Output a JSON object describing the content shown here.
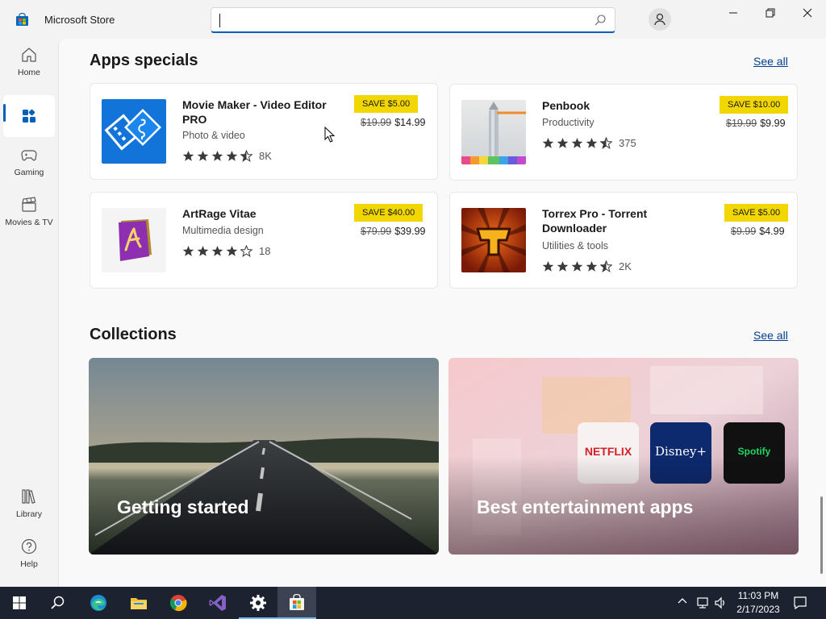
{
  "window": {
    "title": "Microsoft Store",
    "search_value": "",
    "controls": [
      "minimize-icon",
      "restore-icon",
      "close-icon"
    ]
  },
  "nav": {
    "items": [
      {
        "label": "Home",
        "icon": "home-icon"
      },
      {
        "label": "",
        "icon": "apps-icon",
        "active": true
      },
      {
        "label": "Gaming",
        "icon": "gamepad-icon"
      },
      {
        "label": "Movies & TV",
        "icon": "clapper-icon"
      },
      {
        "label": "Library",
        "icon": "library-icon"
      },
      {
        "label": "Help",
        "icon": "help-icon"
      }
    ]
  },
  "specials": {
    "title": "Apps specials",
    "see_all": "See all",
    "apps": [
      {
        "name": "Movie Maker - Video Editor PRO",
        "category": "Photo & video",
        "rating": 4.5,
        "rating_count": "8K",
        "save": "SAVE $5.00",
        "old_price": "$19.99",
        "price": "$14.99"
      },
      {
        "name": "Penbook",
        "category": "Productivity",
        "rating": 4.5,
        "rating_count": "375",
        "save": "SAVE $10.00",
        "old_price": "$19.99",
        "price": "$9.99"
      },
      {
        "name": "ArtRage Vitae",
        "category": "Multimedia design",
        "rating": 4,
        "rating_count": "18",
        "save": "SAVE $40.00",
        "old_price": "$79.99",
        "price": "$39.99"
      },
      {
        "name": "Torrex Pro - Torrent Downloader",
        "category": "Utilities & tools",
        "rating": 4.5,
        "rating_count": "2K",
        "save": "SAVE $5.00",
        "old_price": "$9.99",
        "price": "$4.99"
      }
    ]
  },
  "collections": {
    "title": "Collections",
    "see_all": "See all",
    "items": [
      {
        "label": "Getting started"
      },
      {
        "label": "Best entertainment apps",
        "logos": [
          "NETFLIX",
          "Disney+",
          "Spotify"
        ]
      }
    ]
  },
  "taskbar": {
    "apps": [
      "start-icon",
      "search-icon",
      "edge-icon",
      "file-explorer-icon",
      "chrome-icon",
      "visual-studio-icon",
      "settings-icon",
      "store-icon"
    ],
    "time": "11:03 PM",
    "date": "2/17/2023"
  },
  "colors": {
    "accent": "#005fb8",
    "sale_badge": "#f2d600",
    "link": "#003e92",
    "taskbar": "#1c2230"
  }
}
